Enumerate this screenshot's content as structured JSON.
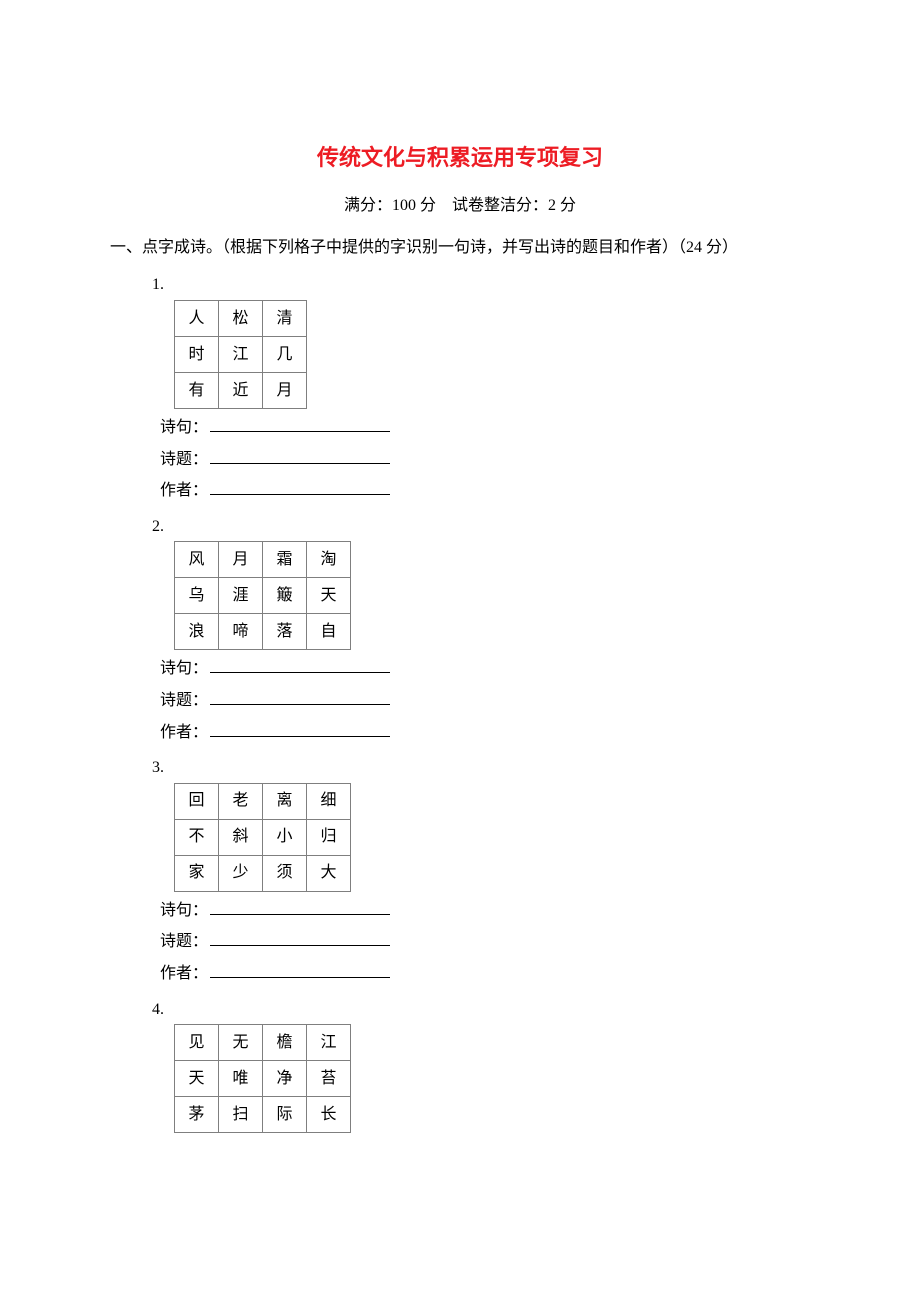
{
  "title": "传统文化与积累运用专项复习",
  "score_line": "满分：100 分　试卷整洁分：2 分",
  "section_heading": "一、点字成诗。（根据下列格子中提供的字识别一句诗，并写出诗的题目和作者）（24 分）",
  "field_labels": {
    "line": "诗句：",
    "title": "诗题：",
    "author": "作者："
  },
  "questions": [
    {
      "number": "1.",
      "grid": [
        [
          "人",
          "松",
          "清"
        ],
        [
          "时",
          "江",
          "几"
        ],
        [
          "有",
          "近",
          "月"
        ]
      ],
      "show_fields": true
    },
    {
      "number": "2.",
      "grid": [
        [
          "风",
          "月",
          "霜",
          "淘"
        ],
        [
          "乌",
          "涯",
          "簸",
          "天"
        ],
        [
          "浪",
          "啼",
          "落",
          "自"
        ]
      ],
      "show_fields": true
    },
    {
      "number": "3.",
      "grid": [
        [
          "回",
          "老",
          "离",
          "细"
        ],
        [
          "不",
          "斜",
          "小",
          "归"
        ],
        [
          "家",
          "少",
          "须",
          "大"
        ]
      ],
      "show_fields": true
    },
    {
      "number": "4.",
      "grid": [
        [
          "见",
          "无",
          "檐",
          "江"
        ],
        [
          "天",
          "唯",
          "净",
          "苔"
        ],
        [
          "茅",
          "扫",
          "际",
          "长"
        ]
      ],
      "show_fields": false
    }
  ]
}
